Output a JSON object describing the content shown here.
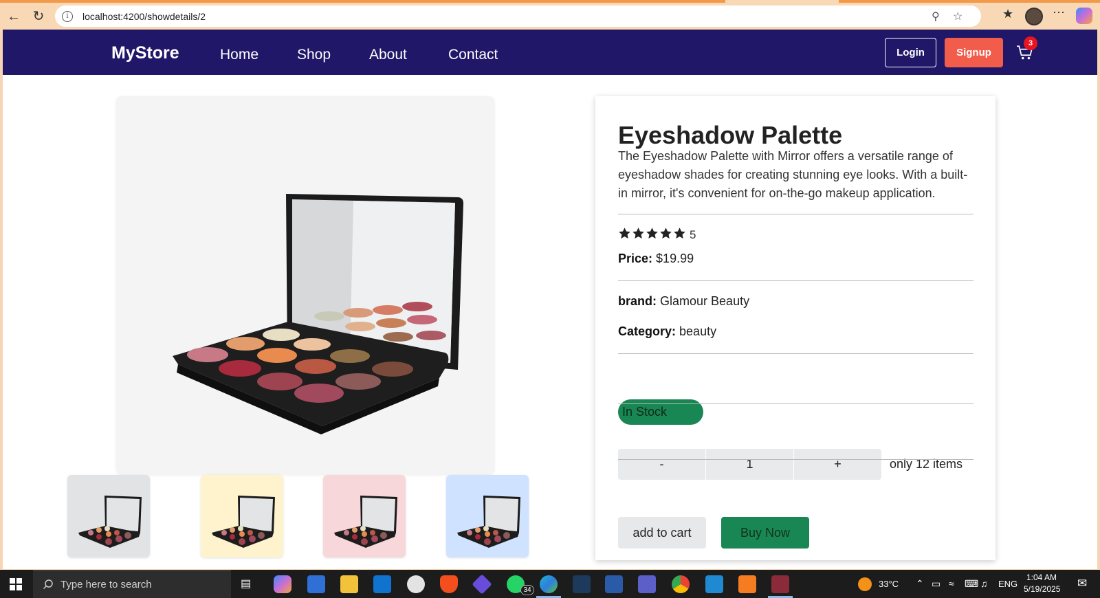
{
  "browser": {
    "url": "localhost:4200/showdetails/2",
    "icons": [
      "back-icon",
      "refresh-icon",
      "info-icon",
      "zoom-icon",
      "favorite-star-icon",
      "favorites-icon",
      "profile-avatar",
      "more-icon",
      "copilot-icon"
    ]
  },
  "navbar": {
    "brand": "MyStore",
    "links": [
      "Home",
      "Shop",
      "About",
      "Contact"
    ],
    "login_label": "Login",
    "signup_label": "Signup",
    "cart_count": "3",
    "colors": {
      "navbar_bg": "#211768",
      "signup_bg": "#f25c4b",
      "badge_bg": "#e8141f"
    }
  },
  "product": {
    "title": "Eyeshadow Palette",
    "description": "The Eyeshadow Palette with Mirror offers a versatile range of eyeshadow shades for creating stunning eye looks. With a built-in mirror, it's convenient for on-the-go makeup application.",
    "rating": "5",
    "rating_stars": 5,
    "price_label": "Price:",
    "price": "$19.99",
    "brand_label": "brand:",
    "brand": "Glamour Beauty",
    "category_label": "Category:",
    "category": "beauty",
    "stock_status": "In Stock",
    "quantity": {
      "minus_label": "-",
      "value": "1",
      "plus_label": "+",
      "note": "only 12 items"
    },
    "add_to_cart_label": "add to cart",
    "buy_now_label": "Buy Now",
    "colors": {
      "stock_bg": "#198754",
      "buy_bg": "#198754"
    },
    "thumbnails": [
      {
        "bg": "#e2e3e5"
      },
      {
        "bg": "#fff3cd"
      },
      {
        "bg": "#f8d7da"
      },
      {
        "bg": "#cfe2ff"
      }
    ]
  },
  "taskbar": {
    "search_placeholder": "Type here to search",
    "whatsapp_badge": "34",
    "temperature": "33°C",
    "language": "ENG",
    "time": "1:04 AM",
    "date": "5/19/2025"
  }
}
